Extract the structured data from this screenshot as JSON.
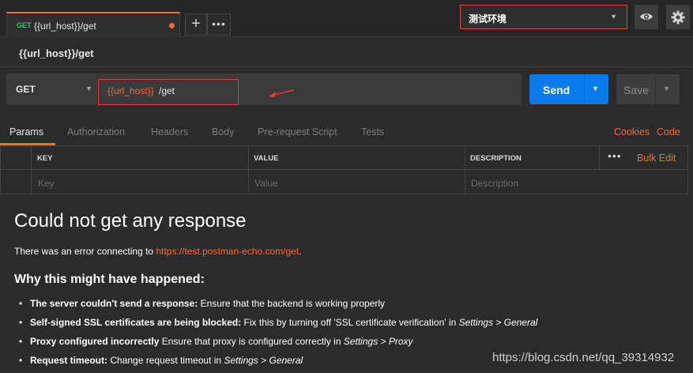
{
  "tab": {
    "method": "GET",
    "title": "{{url_host}}/get",
    "add_label": "+",
    "more_label": "•••"
  },
  "environment": {
    "selected": "测试环境"
  },
  "icons": {
    "eye": "eye-icon",
    "settings": "gear-icon"
  },
  "request": {
    "name": "{{url_host}}/get",
    "method": "GET",
    "url_variable": "{{url_host}}",
    "url_path": "/get",
    "send_label": "Send",
    "save_label": "Save"
  },
  "subtabs": {
    "items": [
      "Params",
      "Authorization",
      "Headers",
      "Body",
      "Pre-request Script",
      "Tests"
    ],
    "active": "Params",
    "cookies_label": "Cookies",
    "code_label": "Code"
  },
  "params": {
    "headers": [
      "KEY",
      "VALUE",
      "DESCRIPTION"
    ],
    "placeholders": [
      "Key",
      "Value",
      "Description"
    ],
    "more_label": "•••",
    "bulk_edit_label": "Bulk Edit"
  },
  "response": {
    "title": "Could not get any response",
    "message_prefix": "There was an error connecting to ",
    "message_link": "https://test.postman-echo.com/get",
    "message_suffix": ".",
    "why_heading": "Why this might have happened:",
    "reasons": [
      {
        "bold": "The server couldn't send a response:",
        "text": " Ensure that the backend is working properly",
        "italic1": "",
        "mid": "",
        "italic2": ""
      },
      {
        "bold": "Self-signed SSL certificates are being blocked:",
        "text": " Fix this by turning off 'SSL certificate verification' in ",
        "italic1": "Settings",
        "mid": " > ",
        "italic2": "General"
      },
      {
        "bold": "Proxy configured incorrectly",
        "text": " Ensure that proxy is configured correctly in ",
        "italic1": "Settings",
        "mid": " > ",
        "italic2": "Proxy"
      },
      {
        "bold": "Request timeout:",
        "text": " Change request timeout in ",
        "italic1": "Settings",
        "mid": " > ",
        "italic2": "General"
      }
    ]
  },
  "watermark": "https://blog.csdn.net/qq_39314932",
  "colors": {
    "accent": "#f26b3a",
    "send_blue": "#097bed",
    "highlight_red": "#e43b3b",
    "method_green": "#4dbd74"
  }
}
